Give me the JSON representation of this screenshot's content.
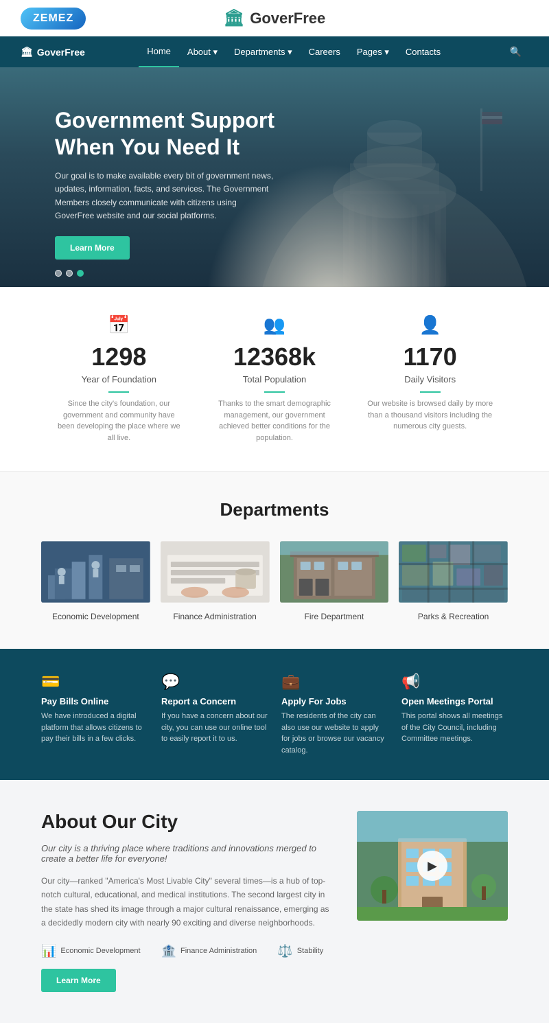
{
  "brand": {
    "zemez_label": "ZEMEZ",
    "site_name": "GoverFree"
  },
  "navbar": {
    "brand": "GoverFree",
    "links": [
      {
        "label": "Home",
        "active": true
      },
      {
        "label": "About",
        "has_dropdown": true
      },
      {
        "label": "Departments",
        "has_dropdown": true
      },
      {
        "label": "Careers",
        "has_dropdown": false
      },
      {
        "label": "Pages",
        "has_dropdown": true
      },
      {
        "label": "Contacts",
        "has_dropdown": false
      }
    ]
  },
  "hero": {
    "title": "Government Support\nWhen You Need It",
    "subtitle": "Our goal is to make available every bit of government news, updates, information, facts, and services. The Government Members closely communicate with citizens using GoverFree website and our social platforms.",
    "button_label": "Learn More",
    "dots": [
      {
        "active": false
      },
      {
        "active": false
      },
      {
        "active": true
      }
    ]
  },
  "stats": [
    {
      "icon": "📅",
      "number": "1298",
      "label": "Year of Foundation",
      "description": "Since the city's foundation, our government and community have been developing the place where we all live."
    },
    {
      "icon": "👥",
      "number": "12368k",
      "label": "Total Population",
      "description": "Thanks to the smart demographic management, our government achieved better conditions for the population."
    },
    {
      "icon": "👤",
      "number": "1170",
      "label": "Daily Visitors",
      "description": "Our website is browsed daily by more than a thousand visitors including the numerous city guests."
    }
  ],
  "departments": {
    "title": "Departments",
    "items": [
      {
        "name": "Economic Development",
        "color": "#3a5a7a"
      },
      {
        "name": "Finance Administration",
        "color": "#7a8a9a"
      },
      {
        "name": "Fire Department",
        "color": "#5a7a6a"
      },
      {
        "name": "Parks & Recreation",
        "color": "#6a8a7a"
      }
    ]
  },
  "services": {
    "items": [
      {
        "icon": "💳",
        "title": "Pay Bills Online",
        "description": "We have introduced a digital platform that allows citizens to pay their bills in a few clicks."
      },
      {
        "icon": "💬",
        "title": "Report a Concern",
        "description": "If you have a concern about our city, you can use our online tool to easily report it to us."
      },
      {
        "icon": "💼",
        "title": "Apply For Jobs",
        "description": "The residents of the city can also use our website to apply for jobs or browse our vacancy catalog."
      },
      {
        "icon": "📢",
        "title": "Open Meetings Portal",
        "description": "This portal shows all meetings of the City Council, including Committee meetings."
      }
    ]
  },
  "about": {
    "title": "About Our City",
    "tagline": "Our city is a thriving place where traditions and innovations merged to create a better life for everyone!",
    "description": "Our city—ranked \"America's Most Livable City\" several times—is a hub of top-notch cultural, educational, and medical institutions. The second largest city in the state has shed its image through a major cultural renaissance, emerging as a decidedly modern city with nearly 90 exciting and diverse neighborhoods.",
    "button_label": "Learn More",
    "icons": [
      {
        "label": "Economic Development"
      },
      {
        "label": "Finance Administration"
      },
      {
        "label": "Stability"
      }
    ]
  }
}
